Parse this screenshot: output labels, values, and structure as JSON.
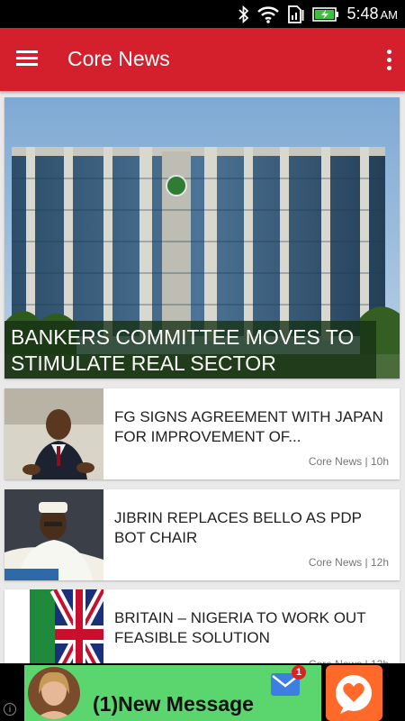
{
  "status_bar": {
    "time": "5:48",
    "ampm": "AM"
  },
  "app_bar": {
    "title": "Core News"
  },
  "featured": {
    "headline": "BANKERS COMMITTEE MOVES TO STIMULATE REAL SECTOR"
  },
  "articles": [
    {
      "headline": "FG SIGNS AGREEMENT WITH JAPAN FOR IMPROVEMENT OF...",
      "source": "Core News",
      "age": "10h"
    },
    {
      "headline": "JIBRIN REPLACES BELLO AS PDP BOT CHAIR",
      "source": "Core News",
      "age": "12h"
    },
    {
      "headline": "BRITAIN – NIGERIA TO WORK OUT FEASIBLE SOLUTION",
      "source": "Core News",
      "age": "12h"
    }
  ],
  "ad": {
    "text": "(1)New Message",
    "badge_count": "1",
    "info": "i"
  },
  "colors": {
    "app_bar": "#d4202c",
    "ad_green": "#5bd56d",
    "ad_orange": "#ff6a2b"
  }
}
